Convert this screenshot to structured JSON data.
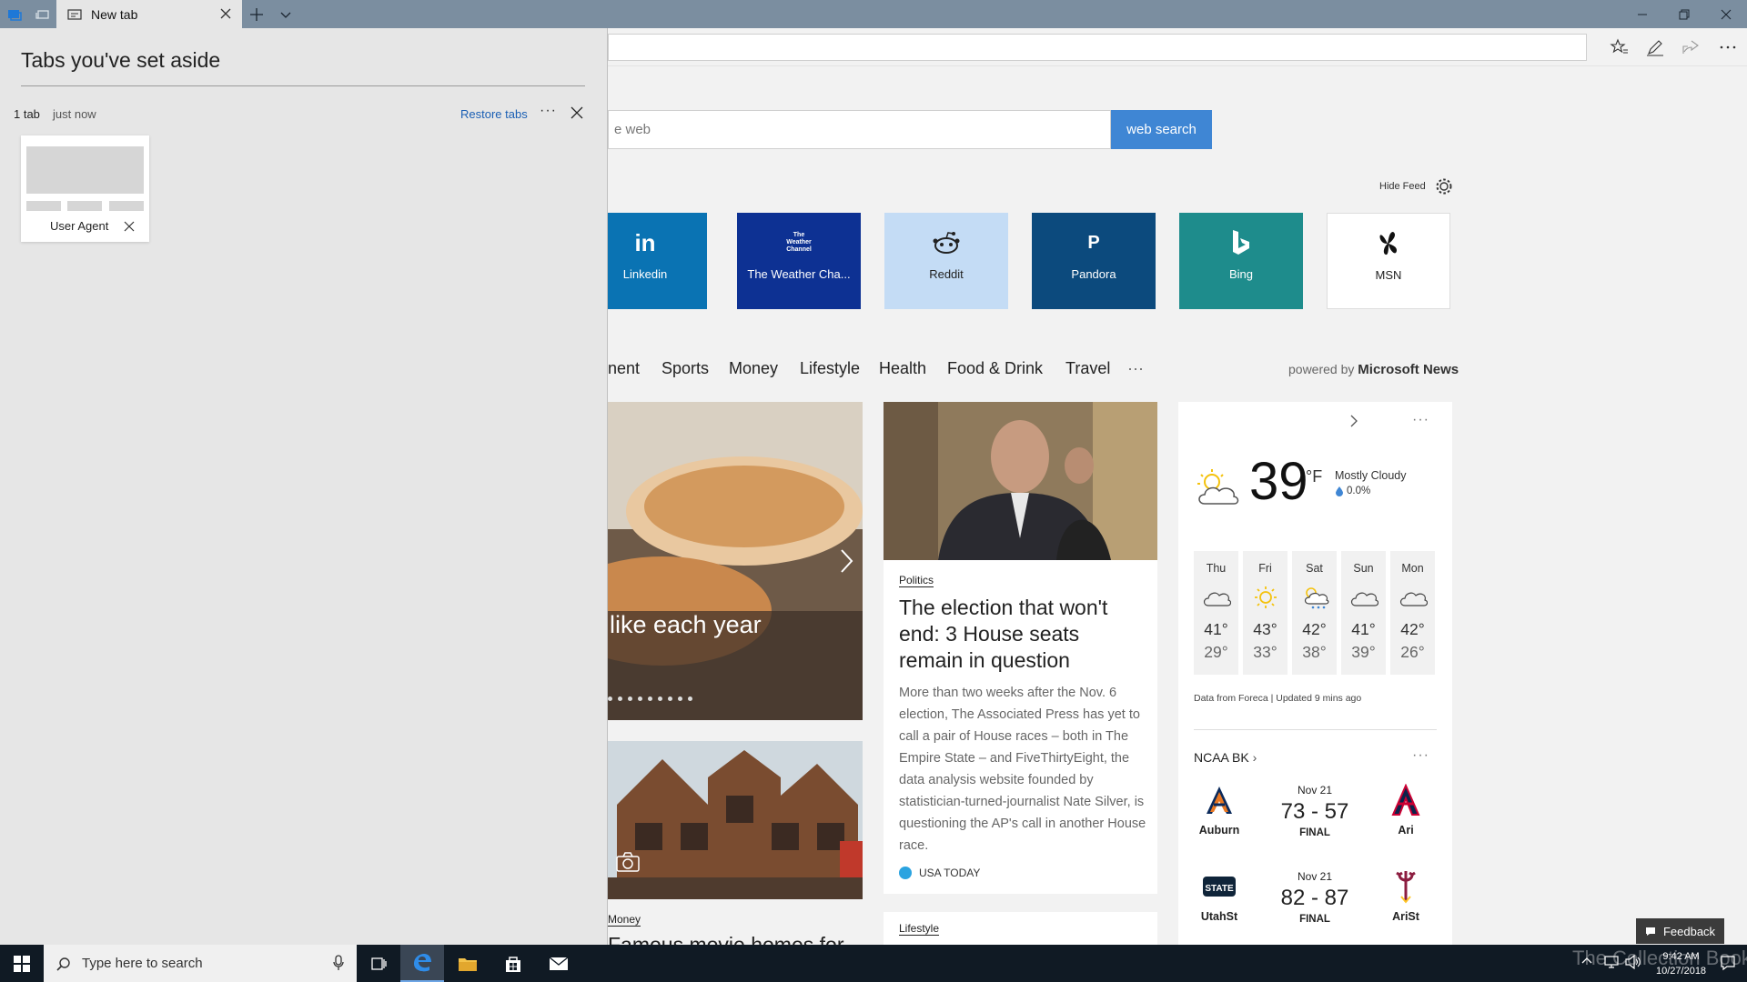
{
  "browser": {
    "tab_title": "New tab",
    "search_placeholder": "e web",
    "search_button": "web search",
    "hide_feed": "Hide Feed"
  },
  "top_sites": [
    {
      "label": "Linkedin",
      "logo": "in",
      "color": "#0a73b3"
    },
    {
      "label": "The Weather Cha...",
      "logo": "The Weather Channel",
      "color": "#0d3193"
    },
    {
      "label": "Reddit",
      "logo": "reddit-alien-icon",
      "color": "#c4dcf5"
    },
    {
      "label": "Pandora",
      "logo": "P",
      "color": "#0c4a7d"
    },
    {
      "label": "Bing",
      "logo": "bing-icon",
      "color": "#1e8c8c"
    },
    {
      "label": "MSN",
      "logo": "msn-butterfly-icon",
      "color": "#ffffff"
    }
  ],
  "categories": [
    "nent",
    "Sports",
    "Money",
    "Lifestyle",
    "Health",
    "Food & Drink",
    "Travel",
    "···"
  ],
  "powered_by": {
    "prefix": "powered by",
    "brand": "Microsoft News"
  },
  "feed": {
    "hero_title": "like each year",
    "politics": {
      "badge": "Politics",
      "headline": "The election that won't end: 3 House seats remain in question",
      "body": "More than two weeks after the Nov. 6 election, The Associated Press has yet to call a pair of House races – both in The Empire State – and FiveThirtyEight, the data analysis website founded by statistician-turned-journalist Nate Silver, is questioning the AP's call in another House race.",
      "source": "USA TODAY"
    },
    "money": {
      "badge": "Money",
      "headline": "Famous movie homes for"
    },
    "lifestyle": {
      "badge": "Lifestyle"
    }
  },
  "weather": {
    "temp": "39",
    "unit": "°F",
    "condition": "Mostly Cloudy",
    "precip": "0.0%",
    "forecast": [
      {
        "day": "Thu",
        "hi": "41°",
        "lo": "29°",
        "icon": "cloud-icon"
      },
      {
        "day": "Fri",
        "hi": "43°",
        "lo": "33°",
        "icon": "sun-icon"
      },
      {
        "day": "Sat",
        "hi": "42°",
        "lo": "38°",
        "icon": "sun-rain-icon"
      },
      {
        "day": "Sun",
        "hi": "41°",
        "lo": "39°",
        "icon": "cloud-icon"
      },
      {
        "day": "Mon",
        "hi": "42°",
        "lo": "26°",
        "icon": "cloud-icon"
      }
    ],
    "source": "Data from Foreca | Updated 9 mins ago"
  },
  "ncaa": {
    "title": "NCAA BK",
    "games": [
      {
        "date": "Nov 21",
        "score": "73 - 57",
        "status": "FINAL",
        "home": "Auburn",
        "away": "Ari"
      },
      {
        "date": "Nov 21",
        "score": "82 - 87",
        "status": "FINAL",
        "home": "UtahSt",
        "away": "AriSt"
      }
    ]
  },
  "aside": {
    "title": "Tabs you've set aside",
    "count": "1 tab",
    "time": "just now",
    "restore": "Restore tabs",
    "more": "···",
    "tab_title": "User Agent"
  },
  "feedback": "Feedback",
  "taskbar": {
    "search_placeholder": "Type here to search",
    "time": "9:42 AM",
    "date": "10/27/2018"
  },
  "watermark": "The Collection Book",
  "colors": {
    "accent": "#3f86d4",
    "titlebar": "#7b8ea0",
    "taskbar": "#101a24",
    "panel": "#e6e6e6"
  }
}
